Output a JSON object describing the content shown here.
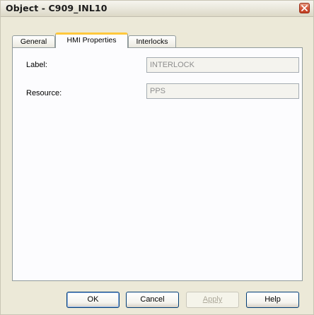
{
  "window": {
    "title": "Object - C909_INL10"
  },
  "tabs": [
    {
      "label": "General"
    },
    {
      "label": "HMI Properties"
    },
    {
      "label": "Interlocks"
    }
  ],
  "fields": {
    "label": {
      "caption": "Label:",
      "value": "INTERLOCK"
    },
    "resource": {
      "caption": "Resource:",
      "value": "PPS"
    }
  },
  "buttons": {
    "ok": "OK",
    "cancel": "Cancel",
    "apply": "Apply",
    "help": "Help"
  },
  "colors": {
    "dialog_bg": "#ECE9D8",
    "active_tab_accent": "#FFC83C",
    "close_button": "#D4573A"
  }
}
